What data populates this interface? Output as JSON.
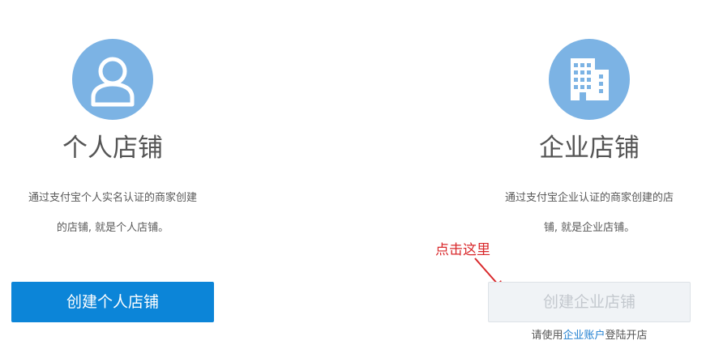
{
  "personal_card": {
    "icon": "user-icon",
    "title": "个人店铺",
    "description_line1": "通过支付宝个人实名认证的商家创建",
    "description_line2": "的店铺, 就是个人店铺。",
    "button_label": "创建个人店铺"
  },
  "enterprise_card": {
    "icon": "building-icon",
    "title": "企业店铺",
    "description_line1": "通过支付宝企业认证的商家创建的店",
    "description_line2": "铺, 就是企业店铺。",
    "button_label": "创建企业店铺",
    "hint_prefix": "请使用",
    "hint_link": "企业账户",
    "hint_suffix": "登陆开店"
  },
  "annotation": {
    "text": "点击这里",
    "color": "#d9282b"
  },
  "colors": {
    "icon_circle": "#7cb3e4",
    "primary_button": "#0c85d8",
    "disabled_button_bg": "#f0f3f6",
    "disabled_button_text": "#c3c8ce",
    "link": "#1f7fd1"
  }
}
